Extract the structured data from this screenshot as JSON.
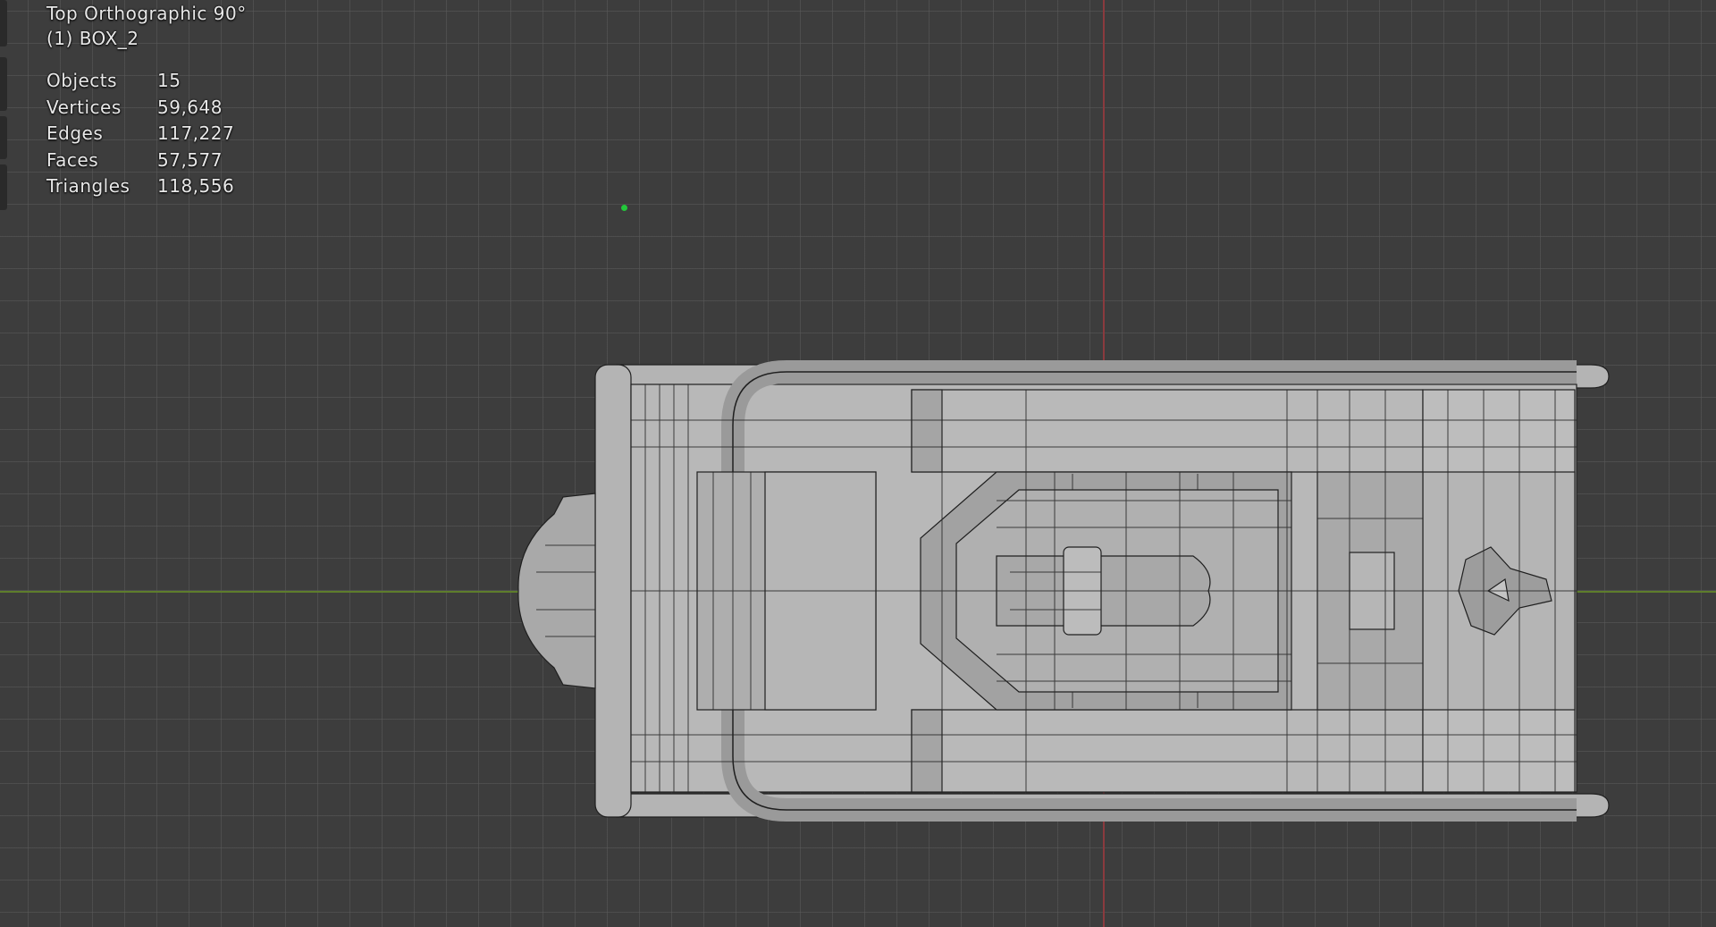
{
  "viewport": {
    "view_name": "Top Orthographic 90°",
    "collection_object": "(1) BOX_2",
    "stats": [
      {
        "label": "Objects",
        "value": "15"
      },
      {
        "label": "Vertices",
        "value": "59,648"
      },
      {
        "label": "Edges",
        "value": "117,227"
      },
      {
        "label": "Faces",
        "value": "57,577"
      },
      {
        "label": "Triangles",
        "value": "118,556"
      }
    ]
  },
  "colors": {
    "background": "#3d3d3d",
    "grid": "#5a5a5a",
    "x_axis": "#5e7d2c",
    "y_axis": "#8a3a3e",
    "origin": "#22c83a",
    "mesh_fill": "#b3b3b3",
    "wire": "#1e1e1e"
  }
}
